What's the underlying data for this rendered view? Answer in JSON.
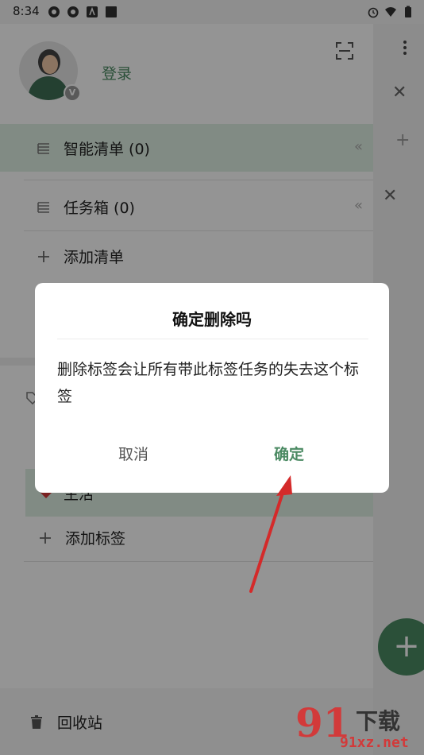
{
  "status_bar": {
    "time": "8:34"
  },
  "drawer": {
    "login_label": "登录",
    "vip_badge": "V",
    "lists": [
      {
        "label": "智能清单 (0)",
        "active": true
      },
      {
        "label": "任务箱 (0)",
        "active": false
      },
      {
        "label": "添加清单",
        "active": false
      }
    ],
    "tags": [
      {
        "label": "生活"
      },
      {
        "label": "添加标签"
      }
    ],
    "recycle_label": "回收站"
  },
  "dialog": {
    "title": "确定删除吗",
    "message": "删除标签会让所有带此标签任务的失去这个标签",
    "cancel_label": "取消",
    "confirm_label": "确定"
  },
  "main_peek": {
    "fab_label": "+"
  },
  "watermark": {
    "logo": "91",
    "cn": "下载",
    "site": "91xz.net"
  },
  "colors": {
    "accent": "#4b8a63",
    "annotation": "#d42a2a"
  }
}
